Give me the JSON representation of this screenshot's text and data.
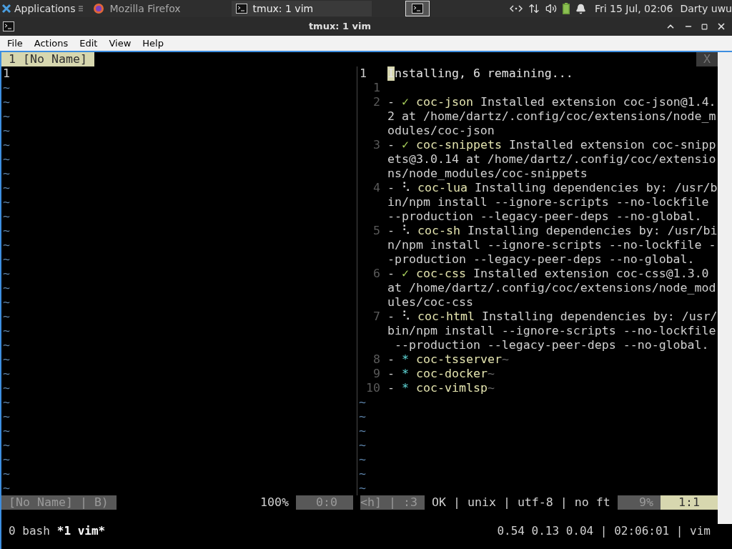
{
  "taskbar": {
    "apps_menu": "Applications",
    "tasks": [
      {
        "title": "Mozilla Firefox",
        "selected": false
      },
      {
        "title": "tmux: 1 vim",
        "selected": true
      }
    ],
    "clock": "Fri 15 Jul, 02:06",
    "user": "Darty uwu"
  },
  "window": {
    "title": "tmux: 1 vim",
    "menu": [
      "File",
      "Actions",
      "Edit",
      "View",
      "Help"
    ]
  },
  "vim": {
    "tabline": {
      "tabs": [
        {
          "label": "1 [No Name]",
          "selected": true
        }
      ],
      "close": "X"
    },
    "left_pane": {
      "lines": [
        "1",
        "~",
        "~",
        "~",
        "~",
        "~",
        "~",
        "~",
        "~",
        "~",
        "~",
        "~",
        "~",
        "~",
        "~",
        "~",
        "~",
        "~",
        "~",
        "~",
        "~",
        "~",
        "~",
        "~",
        "~",
        "~",
        "~",
        "~",
        "~",
        "~"
      ]
    },
    "right_pane": {
      "lines": [
        {
          "kind": "header",
          "number": "1",
          "current": true,
          "cursor": true,
          "rows": [
            "Installing, 6 remaining..."
          ]
        },
        {
          "kind": "blank",
          "number": "1",
          "current": false
        },
        {
          "kind": "item",
          "number": "2",
          "current": false,
          "bullet": "-",
          "marker": {
            "kind": "done",
            "glyph": "✓"
          },
          "name": "coc-json",
          "rows": [
            " Installed extension coc-json@1.4.",
            "2 at /home/dartz/.config/coc/extensions/node_m",
            "odules/coc-json"
          ]
        },
        {
          "kind": "item",
          "number": "3",
          "current": false,
          "bullet": "-",
          "marker": {
            "kind": "done",
            "glyph": "✓"
          },
          "name": "coc-snippets",
          "rows": [
            " Installed extension coc-snipp",
            "ets@3.0.14 at /home/dartz/.config/coc/extensio",
            "ns/node_modules/coc-snippets"
          ]
        },
        {
          "kind": "item",
          "number": "4",
          "current": false,
          "bullet": "-",
          "marker": {
            "kind": "installing",
            "glyph": "⠣"
          },
          "name": "coc-lua",
          "rows": [
            " Installing dependencies by: /usr/b",
            "in/npm install --ignore-scripts --no-lockfile ",
            "--production --legacy-peer-deps --no-global."
          ]
        },
        {
          "kind": "item",
          "number": "5",
          "current": false,
          "bullet": "-",
          "marker": {
            "kind": "installing",
            "glyph": "⠣"
          },
          "name": "coc-sh",
          "rows": [
            " Installing dependencies by: /usr/bi",
            "n/npm install --ignore-scripts --no-lockfile -",
            "-production --legacy-peer-deps --no-global."
          ]
        },
        {
          "kind": "item",
          "number": "6",
          "current": false,
          "bullet": "-",
          "marker": {
            "kind": "done",
            "glyph": "✓"
          },
          "name": "coc-css",
          "rows": [
            " Installed extension coc-css@1.3.0",
            "at /home/dartz/.config/coc/extensions/node_mod",
            "ules/coc-css"
          ]
        },
        {
          "kind": "item",
          "number": "7",
          "current": false,
          "bullet": "-",
          "marker": {
            "kind": "installing",
            "glyph": "⠣"
          },
          "name": "coc-html",
          "rows": [
            " Installing dependencies by: /usr/",
            "bin/npm install --ignore-scripts --no-lockfile",
            " --production --legacy-peer-deps --no-global."
          ]
        },
        {
          "kind": "item",
          "number": "8",
          "current": false,
          "bullet": "-",
          "marker": {
            "kind": "queued",
            "glyph": "*"
          },
          "name": "coc-tsserver",
          "eol": "~"
        },
        {
          "kind": "item",
          "number": "9",
          "current": false,
          "bullet": "-",
          "marker": {
            "kind": "queued",
            "glyph": "*"
          },
          "name": "coc-docker",
          "eol": "~"
        },
        {
          "kind": "item",
          "number": "10",
          "current": false,
          "bullet": "-",
          "marker": {
            "kind": "queued",
            "glyph": "*"
          },
          "name": "coc-vimlsp",
          "eol": "~"
        }
      ],
      "filler": [
        "~",
        "~",
        "~",
        "~",
        "~",
        "~",
        "~"
      ]
    },
    "status_line": {
      "buffer": "[No Name] | B)",
      "percent": "100%",
      "position": "0:0",
      "mode": "<h] | :3",
      "info": "OK | unix | utf-8 | no ft",
      "scroll": "9%",
      "cursor": "1:1"
    }
  },
  "tmux_status": {
    "windows": [
      {
        "label": "0 bash",
        "selected": false
      },
      {
        "label": "*1 vim*",
        "selected": true
      }
    ],
    "right": "0.54 0.13 0.04 | 02:06:01 | vim"
  }
}
